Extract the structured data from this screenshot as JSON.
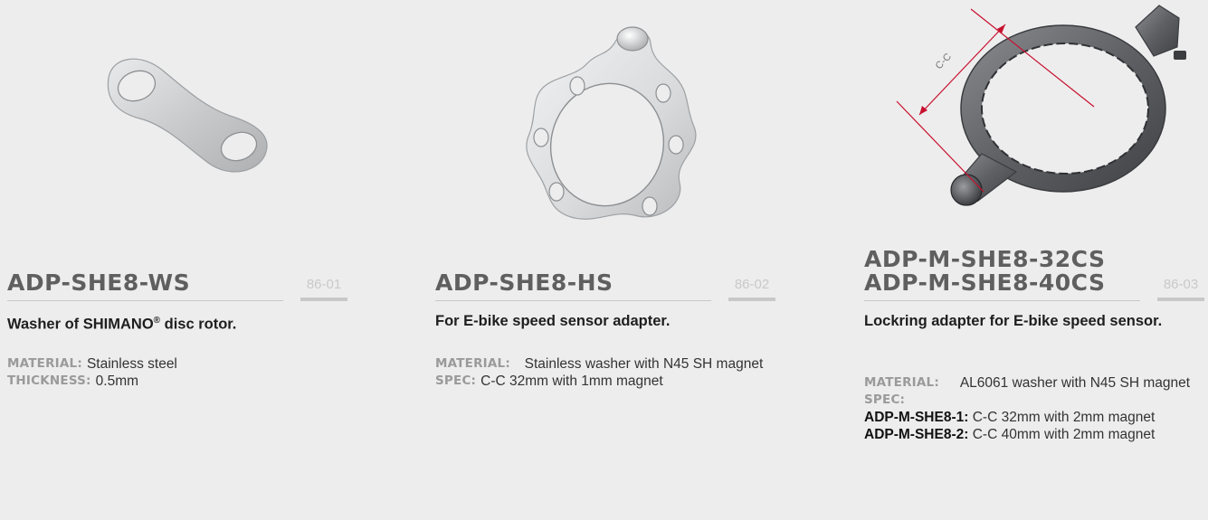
{
  "products": [
    {
      "name_lines": [
        "ADP-SHE8-WS"
      ],
      "code": "86-01",
      "description": "Washer of SHIMANO",
      "description_sup": "®",
      "description_tail": " disc rotor.",
      "specs": [
        {
          "label": "MATERIAL:",
          "value": "Stainless steel"
        },
        {
          "label": "THICKNESS:",
          "value": "0.5mm"
        }
      ]
    },
    {
      "name_lines": [
        "ADP-SHE8-HS"
      ],
      "code": "86-02",
      "description": "For E-bike speed sensor adapter.",
      "specs": [
        {
          "label": "MATERIAL:",
          "value": "Stainless washer with N45 SH magnet"
        },
        {
          "label": "SPEC:",
          "value": "C-C 32mm with 1mm magnet"
        }
      ]
    },
    {
      "name_lines": [
        "ADP-M-SHE8-32CS",
        "ADP-M-SHE8-40CS"
      ],
      "code": "86-03",
      "description": "Lockring adapter for E-bike speed sensor.",
      "dimension_label": "C-C",
      "specs": [
        {
          "label": "MATERIAL:",
          "value": "AL6061 washer with N45 SH magnet"
        },
        {
          "label": "SPEC:",
          "value": ""
        }
      ],
      "variants": [
        {
          "model": "ADP-M-SHE8-1:",
          "value": "C-C 32mm with 2mm magnet"
        },
        {
          "model": "ADP-M-SHE8-2:",
          "value": "C-C 40mm with 2mm magnet"
        }
      ]
    }
  ],
  "colors": {
    "background": "#ededed",
    "title": "#5f5f5f",
    "code": "#c9c9c9",
    "label": "#9a9a9a",
    "dimension_arrow": "#c8102e"
  }
}
